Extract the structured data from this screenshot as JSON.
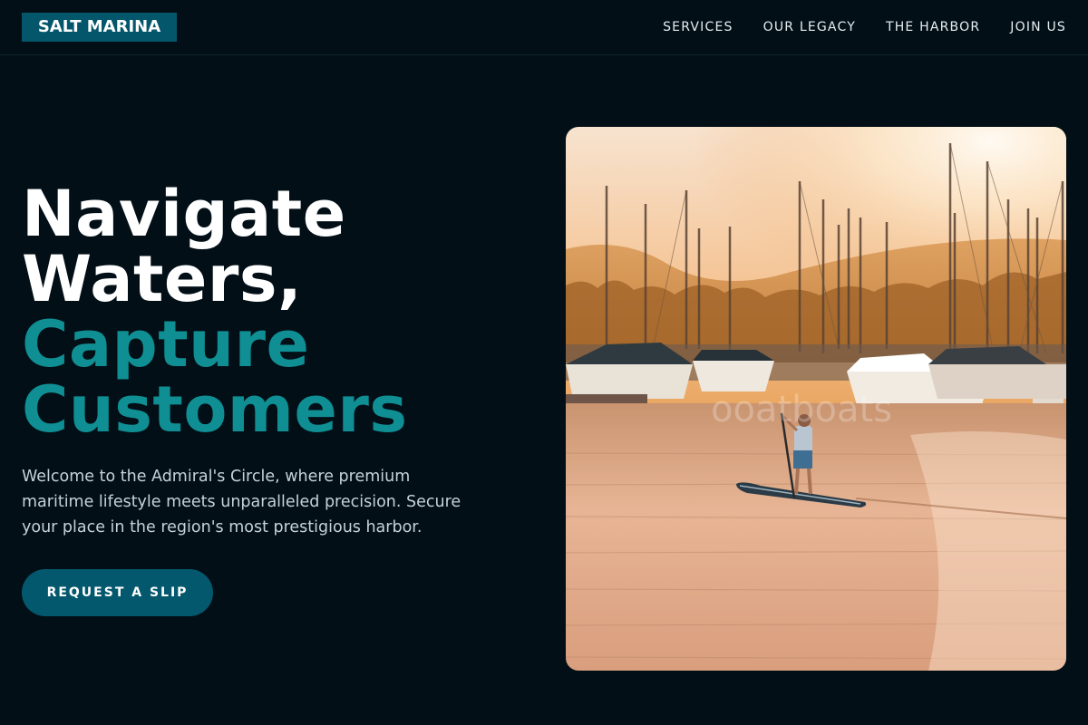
{
  "brand": {
    "name": "SALT MARINA"
  },
  "nav": {
    "items": [
      "SERVICES",
      "OUR LEGACY",
      "THE HARBOR",
      "JOIN US"
    ]
  },
  "hero": {
    "headline_line1": "Navigate",
    "headline_line2": "Waters,",
    "headline_accent1": "Capture",
    "headline_accent2": "Customers",
    "subtext": "Welcome to the Admiral's Circle, where premium maritime lifestyle meets unparalleled precision. Secure your place in the region's most prestigious harbor.",
    "cta_label": "REQUEST A SLIP"
  },
  "image": {
    "description": "marina-at-sunset-paddleboarder",
    "watermark": "ooatboats"
  },
  "colors": {
    "background": "#020f17",
    "brand": "#04576b",
    "accent": "#0f8f93"
  }
}
